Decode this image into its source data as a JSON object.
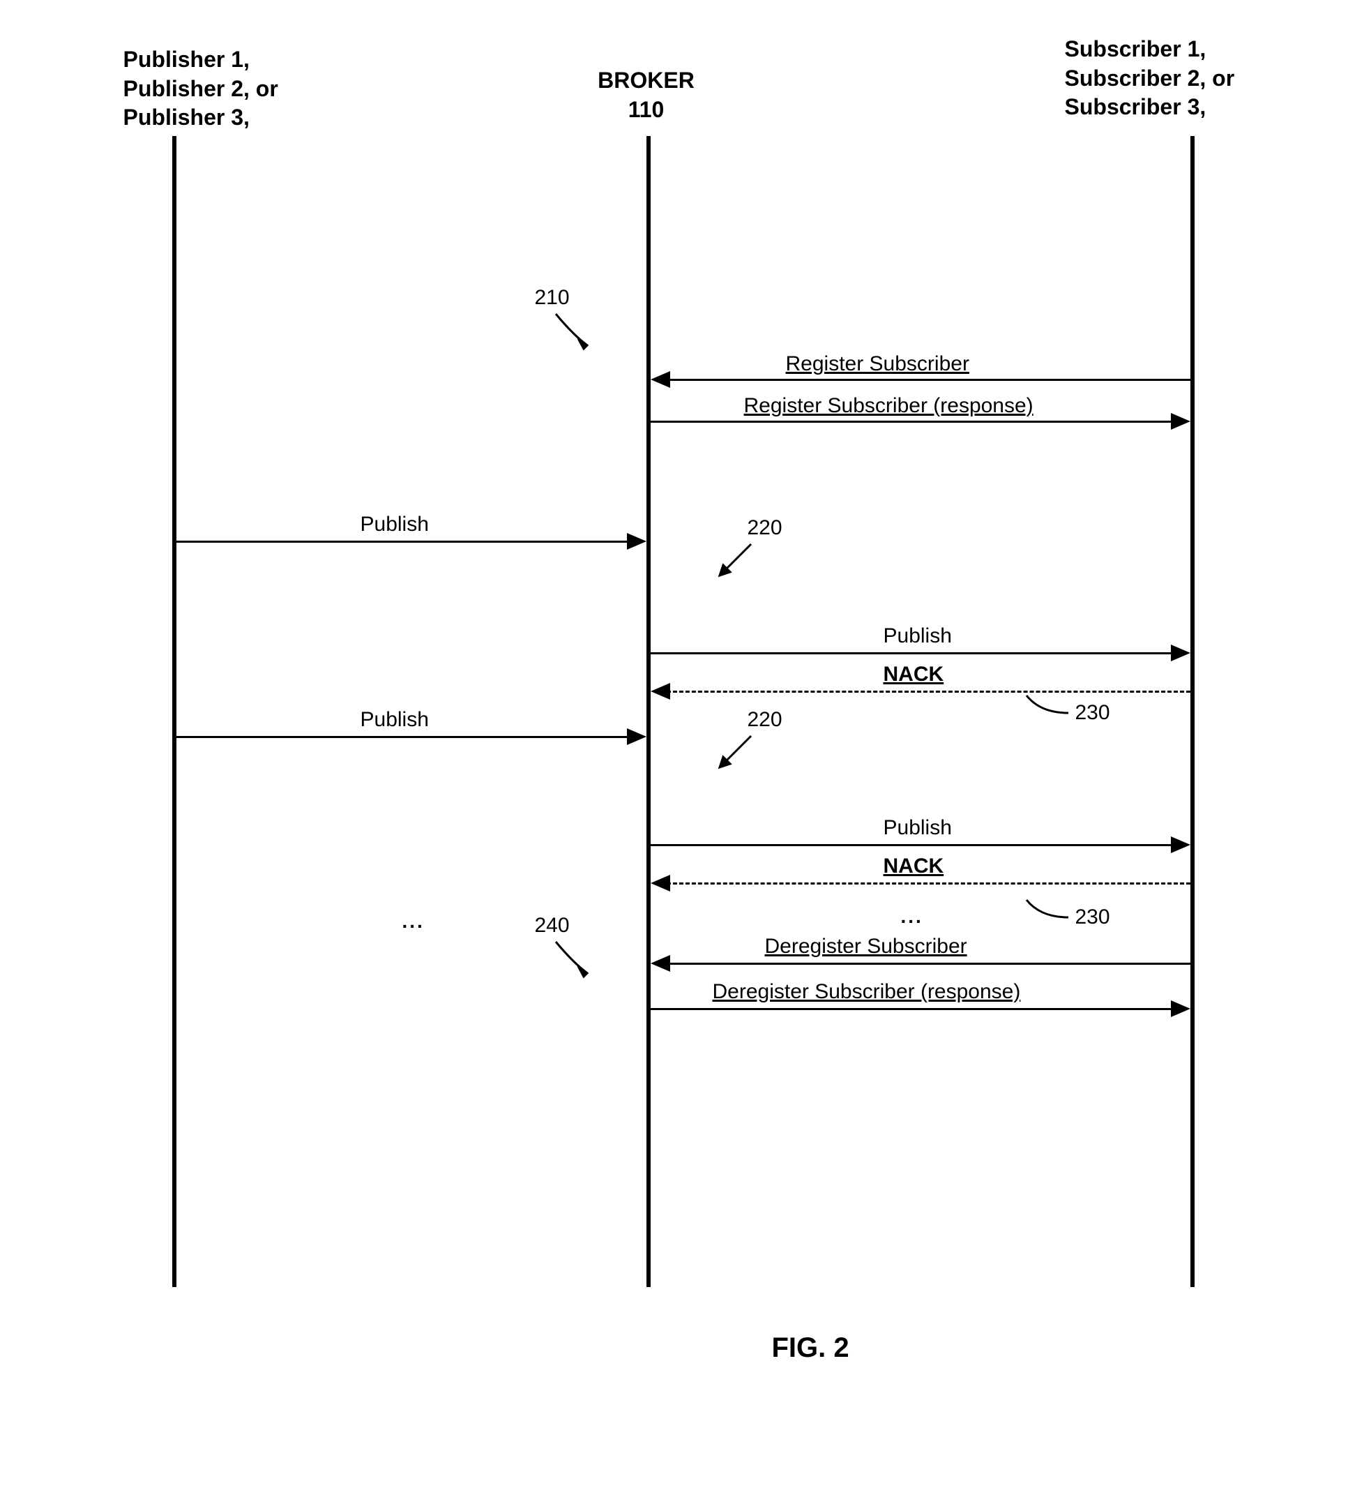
{
  "participants": {
    "publisher": {
      "line1": "Publisher 1,",
      "line2": "Publisher 2, or",
      "line3": "Publisher 3,"
    },
    "broker": {
      "line1": "BROKER",
      "line2": "110"
    },
    "subscriber": {
      "line1": "Subscriber 1,",
      "line2": "Subscriber 2, or",
      "line3": "Subscriber 3,"
    }
  },
  "messages": {
    "register": "Register Subscriber",
    "register_resp": "Register Subscriber (response)",
    "publish": "Publish",
    "nack": "NACK",
    "deregister": "Deregister Subscriber",
    "deregister_resp": "Deregister Subscriber (response)"
  },
  "refs": {
    "r210": "210",
    "r220a": "220",
    "r220b": "220",
    "r230a": "230",
    "r230b": "230",
    "r240": "240"
  },
  "ellipsis1": "...",
  "ellipsis2": "...",
  "figure": "FIG. 2"
}
